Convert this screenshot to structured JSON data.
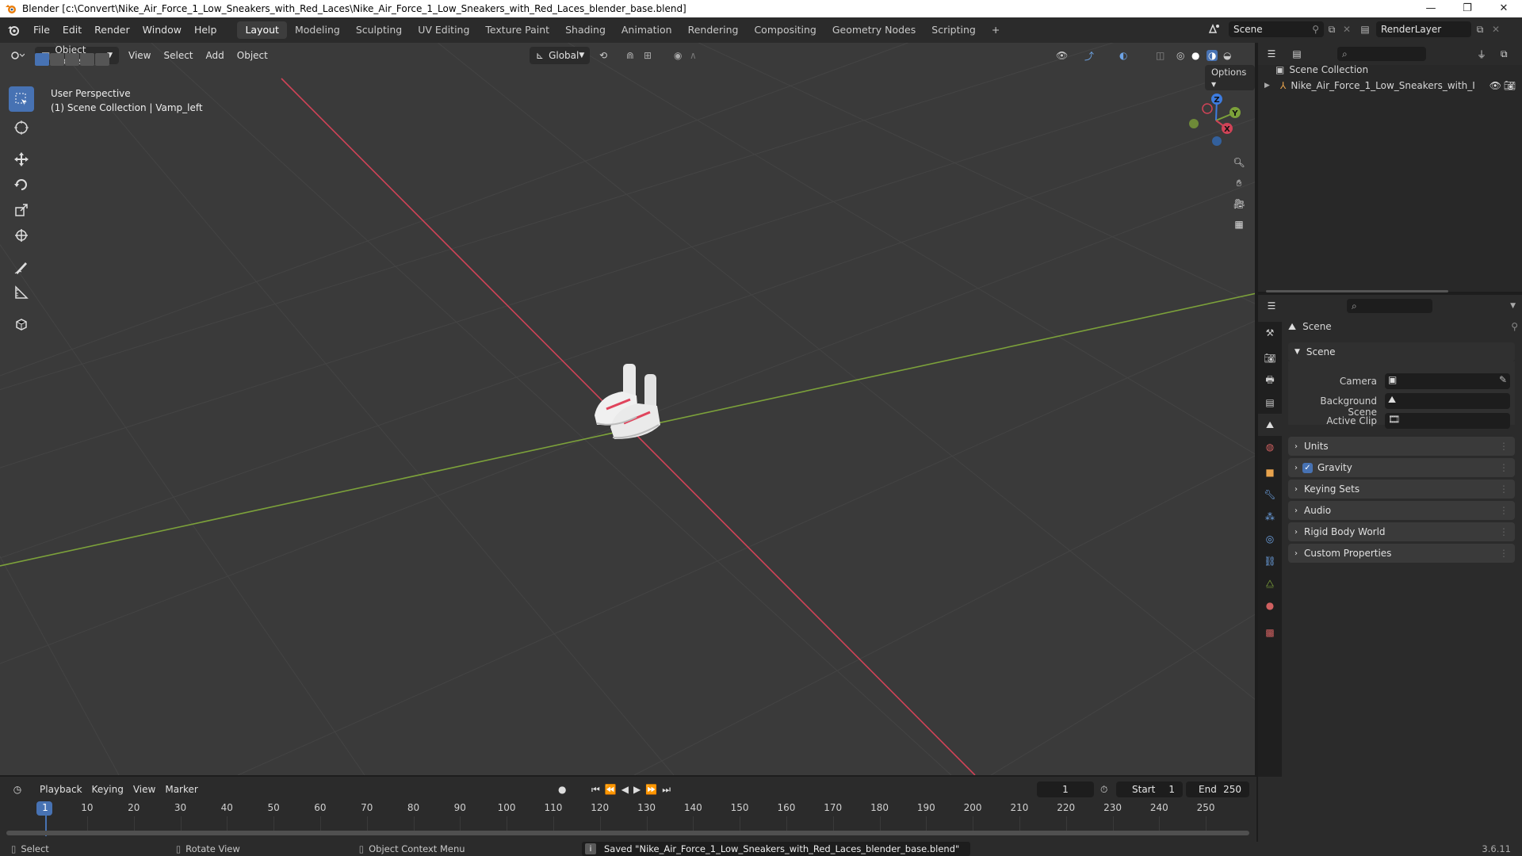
{
  "window": {
    "title": "Blender [c:\\Convert\\Nike_Air_Force_1_Low_Sneakers_with_Red_Laces\\Nike_Air_Force_1_Low_Sneakers_with_Red_Laces_blender_base.blend]",
    "controls": [
      "—",
      "❐",
      "✕"
    ]
  },
  "menu": [
    "File",
    "Edit",
    "Render",
    "Window",
    "Help"
  ],
  "workspaces": [
    {
      "label": "Layout",
      "active": true
    },
    {
      "label": "Modeling"
    },
    {
      "label": "Sculpting"
    },
    {
      "label": "UV Editing"
    },
    {
      "label": "Texture Paint"
    },
    {
      "label": "Shading"
    },
    {
      "label": "Animation"
    },
    {
      "label": "Rendering"
    },
    {
      "label": "Compositing"
    },
    {
      "label": "Geometry Nodes"
    },
    {
      "label": "Scripting"
    }
  ],
  "add_workspace": "+",
  "scene_selector": {
    "value": "Scene"
  },
  "view_layer_selector": {
    "value": "RenderLayer"
  },
  "viewport": {
    "mode": "Object Mode",
    "menus": [
      "View",
      "Select",
      "Add",
      "Object"
    ],
    "transform_orientation": "Global",
    "options_label": "Options",
    "overlay_line1": "User Perspective",
    "overlay_line2": "(1) Scene Collection | Vamp_left",
    "gizmo": {
      "x": "X",
      "y": "Y",
      "z": "Z"
    }
  },
  "outliner": {
    "root": "Scene Collection",
    "items": [
      {
        "label": "Nike_Air_Force_1_Low_Sneakers_with_I"
      }
    ]
  },
  "properties": {
    "context_title": "Scene",
    "panel_scene": "Scene",
    "fields": [
      {
        "label": "Camera",
        "value": ""
      },
      {
        "label": "Background Scene",
        "value": ""
      },
      {
        "label": "Active Clip",
        "value": ""
      }
    ],
    "subpanels": [
      {
        "label": "Units",
        "checkbox": false
      },
      {
        "label": "Gravity",
        "checkbox": true
      },
      {
        "label": "Keying Sets",
        "checkbox": false
      },
      {
        "label": "Audio",
        "checkbox": false
      },
      {
        "label": "Rigid Body World",
        "checkbox": false
      },
      {
        "label": "Custom Properties",
        "checkbox": false
      }
    ]
  },
  "timeline": {
    "menus": [
      "Playback",
      "Keying",
      "View",
      "Marker"
    ],
    "current_frame": "1",
    "start_label": "Start",
    "start": "1",
    "end_label": "End",
    "end": "250",
    "ticks": [
      "1",
      "10",
      "20",
      "30",
      "40",
      "50",
      "60",
      "70",
      "80",
      "90",
      "100",
      "110",
      "120",
      "130",
      "140",
      "150",
      "160",
      "170",
      "180",
      "190",
      "200",
      "210",
      "220",
      "230",
      "240",
      "250"
    ]
  },
  "status": {
    "select": "Select",
    "rotate": "Rotate View",
    "context_menu": "Object Context Menu",
    "message": "Saved \"Nike_Air_Force_1_Low_Sneakers_with_Red_Laces_blender_base.blend\"",
    "version": "3.6.11"
  },
  "colors": {
    "accent": "#4772b3",
    "x_axis": "#d04357",
    "y_axis": "#7ca13a",
    "z_axis": "#3d7ce0",
    "viewport_bg": "#3a3a3a"
  }
}
